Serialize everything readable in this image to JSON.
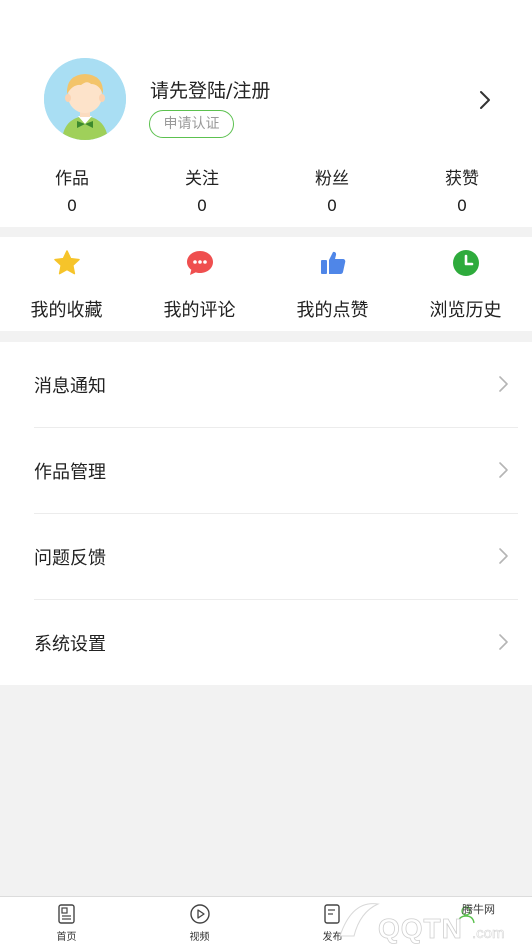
{
  "profile": {
    "login_prompt": "请先登陆/注册",
    "apply_badge": "申请认证"
  },
  "stats": [
    {
      "label": "作品",
      "value": "0"
    },
    {
      "label": "关注",
      "value": "0"
    },
    {
      "label": "粉丝",
      "value": "0"
    },
    {
      "label": "获赞",
      "value": "0"
    }
  ],
  "quick_actions": [
    {
      "label": "我的收藏",
      "icon": "star-icon",
      "color": "#f6c42a"
    },
    {
      "label": "我的评论",
      "icon": "comment-icon",
      "color": "#ef4f4f"
    },
    {
      "label": "我的点赞",
      "icon": "thumbs-up-icon",
      "color": "#4f86e8"
    },
    {
      "label": "浏览历史",
      "icon": "clock-icon",
      "color": "#2eab3c"
    }
  ],
  "menu": [
    {
      "label": "消息通知"
    },
    {
      "label": "作品管理"
    },
    {
      "label": "问题反馈"
    },
    {
      "label": "系统设置"
    }
  ],
  "tabbar": [
    {
      "label": "首页",
      "icon": "home-page-icon"
    },
    {
      "label": "视频",
      "icon": "video-play-icon"
    },
    {
      "label": "发布",
      "icon": "publish-icon"
    },
    {
      "label": "",
      "icon": "profile-icon"
    }
  ],
  "watermark": {
    "brand": "腾牛网",
    "domain": "QQTN.com"
  },
  "colors": {
    "accent_green": "#5cc14f",
    "avatar_bg": "#a9def3"
  }
}
